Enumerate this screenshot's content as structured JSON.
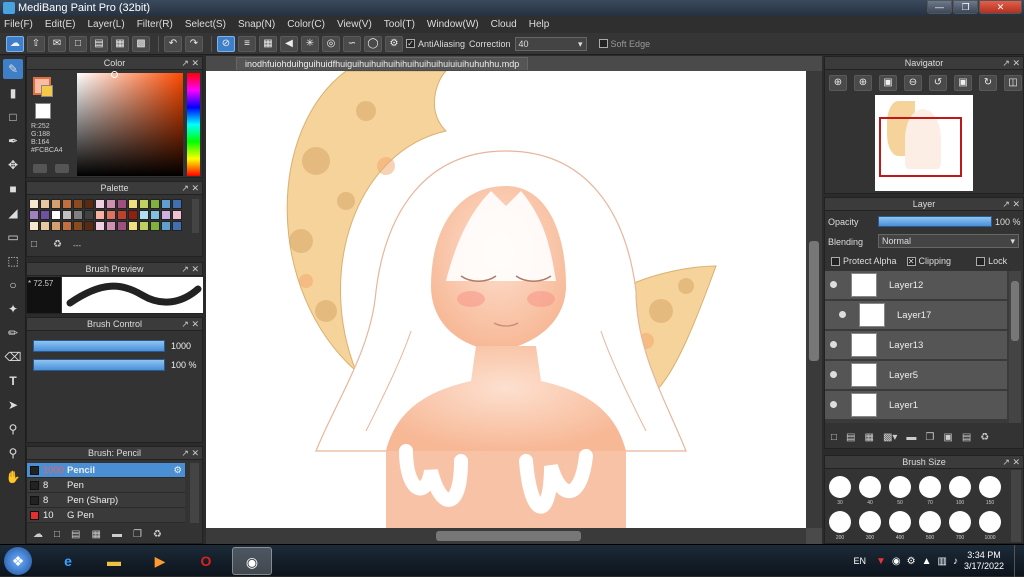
{
  "window": {
    "title": "MediBang Paint Pro (32bit)"
  },
  "menu": [
    "File(F)",
    "Edit(E)",
    "Layer(L)",
    "Filter(R)",
    "Select(S)",
    "Snap(N)",
    "Color(C)",
    "View(V)",
    "Tool(T)",
    "Window(W)",
    "Cloud",
    "Help"
  ],
  "toolbar": {
    "antialiasing_label": "AntiAliasing",
    "correction_label": "Correction",
    "correction_value": "40",
    "soft_edge_label": "Soft Edge"
  },
  "color_panel": {
    "title": "Color",
    "r": "R:252",
    "g": "G:188",
    "b": "B:164",
    "hex": "#FCBCA4",
    "primary_color": "#FCBCA4"
  },
  "palette_panel": {
    "title": "Palette",
    "name": "---"
  },
  "brush_preview": {
    "title": "Brush Preview",
    "size_text": "* 72.57"
  },
  "brush_control": {
    "title": "Brush Control",
    "size_value": "1000",
    "opacity_value": "100 %"
  },
  "brush_list": {
    "title": "Brush: Pencil",
    "items": [
      {
        "size": "1000",
        "name": "Pencil",
        "color": "#222222",
        "selected": true
      },
      {
        "size": "8",
        "name": "Pen",
        "color": "#222222"
      },
      {
        "size": "8",
        "name": "Pen (Sharp)",
        "color": "#222222"
      },
      {
        "size": "10",
        "name": "G Pen",
        "color": "#e03030"
      }
    ]
  },
  "document": {
    "tab": "inodhfuiohduihguihuidfhuiguihuihuihuihihuihuihuihuiuiuihuhuhhu.mdp"
  },
  "navigator": {
    "title": "Navigator"
  },
  "layer_panel": {
    "title": "Layer",
    "opacity_label": "Opacity",
    "opacity_value": "100 %",
    "opacity_fraction": 1.0,
    "blending_label": "Blending",
    "blending_value": "Normal",
    "protect_alpha_label": "Protect Alpha",
    "clipping_label": "Clipping",
    "lock_label": "Lock",
    "layers": [
      "Layer12",
      "Layer17",
      "Layer13",
      "Layer5",
      "Layer1"
    ]
  },
  "brush_size": {
    "title": "Brush Size",
    "sizes": [
      "30",
      "40",
      "50",
      "70",
      "100",
      "150",
      "200",
      "300",
      "400",
      "500",
      "700",
      "1000"
    ]
  },
  "taskbar": {
    "lang": "EN",
    "time": "3:34 PM",
    "date": "3/17/2022"
  }
}
